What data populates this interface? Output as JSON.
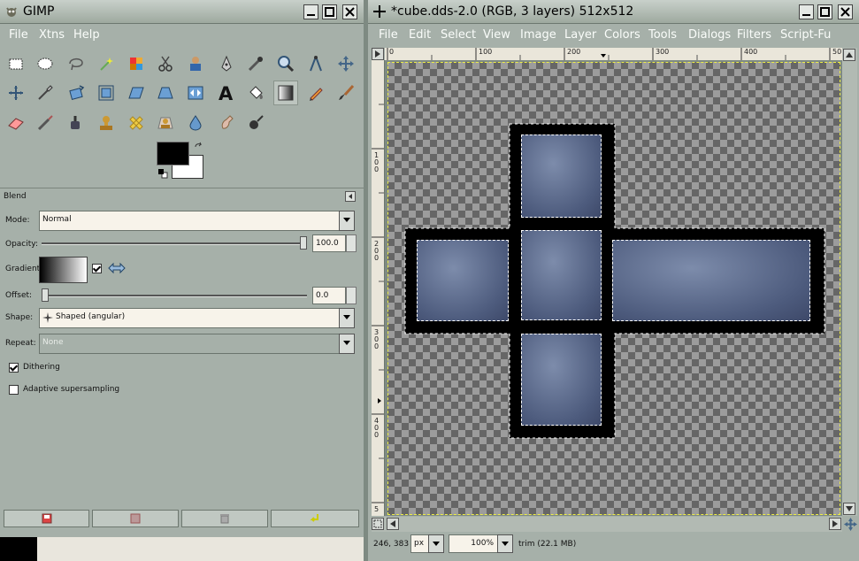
{
  "toolbox": {
    "title": "GIMP",
    "menu": [
      "File",
      "Xtns",
      "Help"
    ],
    "tools": [
      "rect-select",
      "ellipse-select",
      "free-select",
      "fuzzy-select",
      "color-select",
      "scissors",
      "foreground-select",
      "paths",
      "color-picker",
      "zoom",
      "measure",
      "move",
      "align",
      "crop",
      "rotate",
      "scale",
      "shear",
      "perspective",
      "flip",
      "text",
      "bucket-fill",
      "blend",
      "pencil",
      "paintbrush",
      "eraser",
      "airbrush",
      "ink",
      "clone",
      "heal",
      "perspective-clone",
      "convolve",
      "smudge",
      "dodge-burn"
    ],
    "active_tool_index": 21
  },
  "blend": {
    "section_label": "Blend",
    "mode_label": "Mode:",
    "mode_value": "Normal",
    "opacity_label": "Opacity:",
    "opacity_value": "100.0",
    "opacity_fraction": 1.0,
    "gradient_label": "Gradient:",
    "offset_label": "Offset:",
    "offset_value": "0.0",
    "offset_fraction": 0.0,
    "shape_label": "Shape:",
    "shape_value": "Shaped (angular)",
    "repeat_label": "Repeat:",
    "repeat_value": "None",
    "dithering_label": "Dithering",
    "dithering_checked": true,
    "adaptive_label": "Adaptive supersampling",
    "adaptive_checked": false
  },
  "image_window": {
    "title": "*cube.dds-2.0 (RGB, 3 layers) 512x512",
    "menu": [
      "File",
      "Edit",
      "Select",
      "View",
      "Image",
      "Layer",
      "Colors",
      "Tools",
      "Dialogs",
      "Filters",
      "Script-Fu"
    ],
    "hruler": [
      "0",
      "100",
      "200",
      "300",
      "400",
      "50"
    ],
    "vruler": [
      "1\n0\n0",
      "2\n0\n0",
      "3\n0\n0",
      "4\n0\n0",
      "5"
    ],
    "coords": "246, 383",
    "unit": "px",
    "zoom": "100%",
    "status": "trim (22.1 MB)"
  },
  "colors": {
    "foreground": "#000000",
    "background": "#ffffff"
  }
}
